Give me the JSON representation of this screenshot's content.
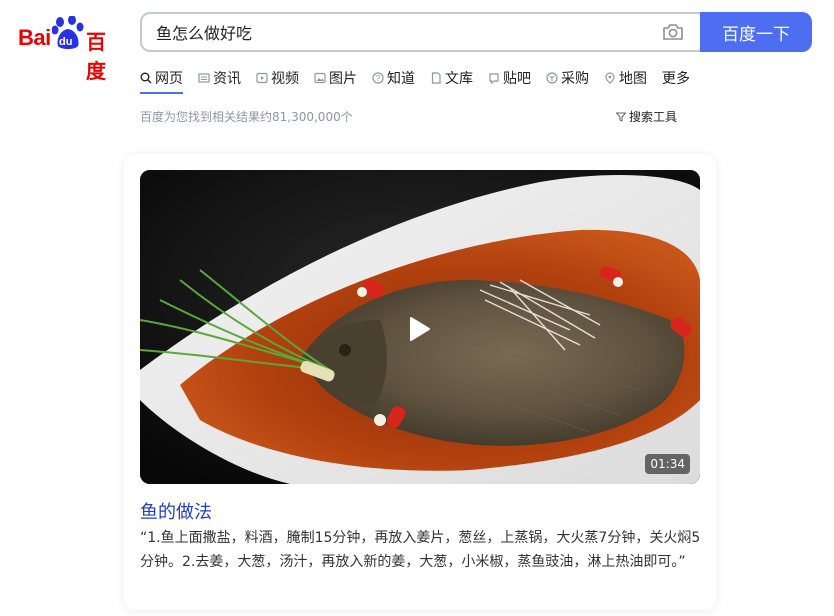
{
  "logo": {
    "text_en": "Bai",
    "text_du": "du",
    "text_cn": "百度"
  },
  "search": {
    "query": "鱼怎么做好吃",
    "button_label": "百度一下"
  },
  "tabs": [
    {
      "label": "网页",
      "icon": "search-icon",
      "active": true
    },
    {
      "label": "资讯",
      "icon": "news-icon"
    },
    {
      "label": "视频",
      "icon": "video-icon"
    },
    {
      "label": "图片",
      "icon": "image-icon"
    },
    {
      "label": "知道",
      "icon": "question-icon"
    },
    {
      "label": "文库",
      "icon": "document-icon"
    },
    {
      "label": "贴吧",
      "icon": "tieba-icon"
    },
    {
      "label": "采购",
      "icon": "purchase-icon"
    },
    {
      "label": "地图",
      "icon": "map-icon"
    },
    {
      "label": "更多"
    }
  ],
  "results": {
    "count_text": "百度为您找到相关结果约81,300,000个",
    "tools_label": "搜索工具"
  },
  "card": {
    "duration": "01:34",
    "title": "鱼的做法",
    "description": "“1.鱼上面撒盐，料酒，腌制15分钟，再放入姜片，葱丝，上蒸锅，大火蒸7分钟，关火焖5分钟。2.去姜，大葱，汤汁，再放入新的姜，大葱，小米椒，蒸鱼豉油，淋上热油即可。”"
  },
  "colors": {
    "brand_red": "#e10602",
    "brand_blue": "#4e6ef2",
    "link_blue": "#2440b3"
  }
}
